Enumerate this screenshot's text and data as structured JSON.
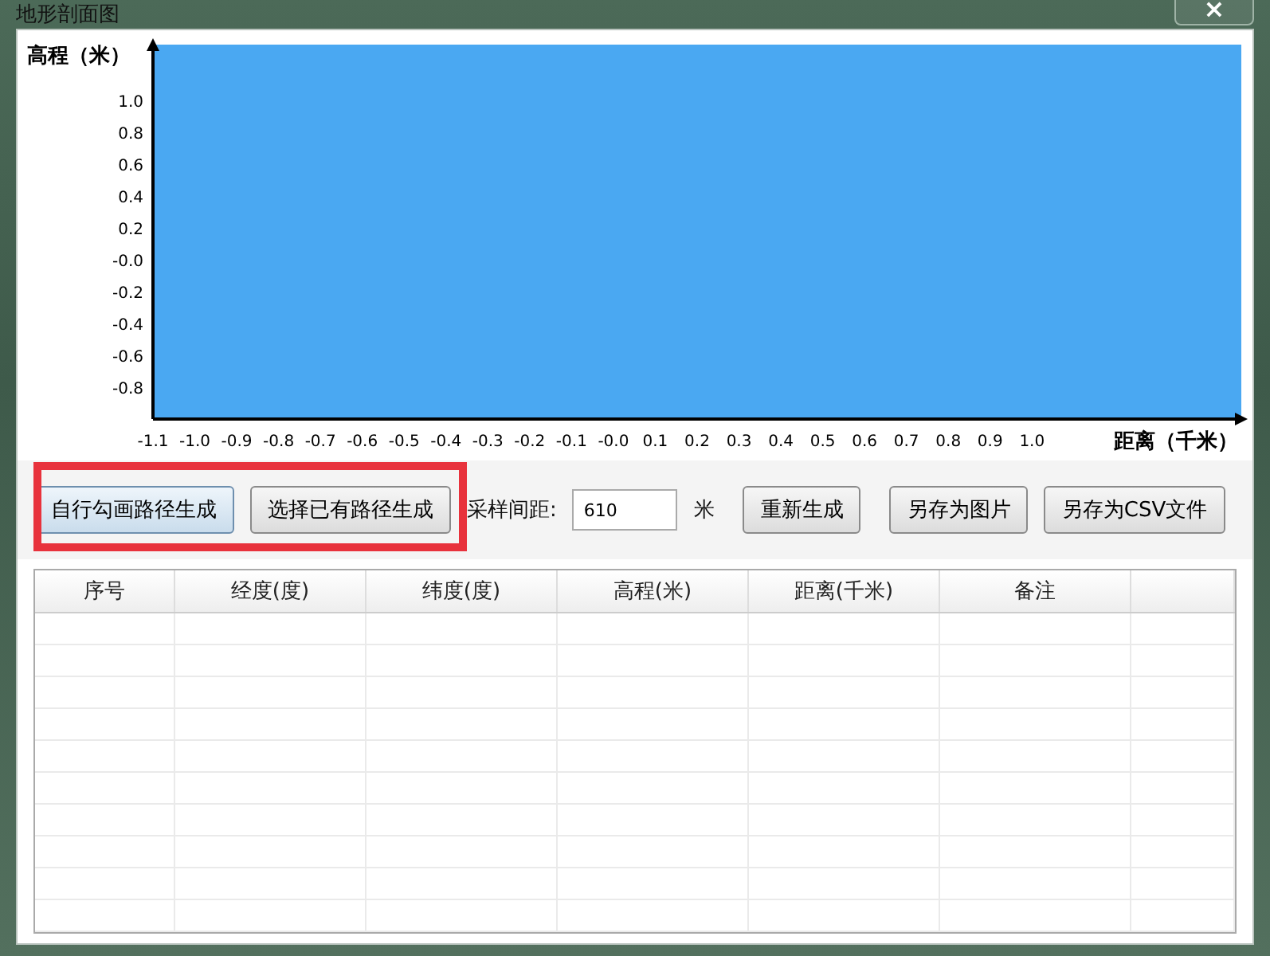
{
  "window": {
    "title": "地形剖面图",
    "close": "×"
  },
  "chart": {
    "chart_data": {
      "type": "area",
      "xlabel": "距离（千米）",
      "ylabel": "高程（米）",
      "xticks": [
        -1.1,
        {
          "value": -1,
          "label": "-1.0"
        },
        -0.9,
        -0.8,
        -0.7,
        -0.6,
        -0.5,
        -0.4,
        -0.3,
        -0.2,
        -0.1,
        {
          "value": 0,
          "label": "-0.0"
        },
        0.1,
        0.2,
        0.3,
        0.4,
        0.5,
        0.6,
        0.7,
        0.8,
        0.9,
        {
          "value": 1,
          "label": "1.0"
        }
      ],
      "yticks": [
        {
          "value": 1,
          "label": "1.0"
        },
        0.8,
        0.6,
        0.4,
        0.2,
        {
          "value": 0,
          "label": "-0.0"
        },
        -0.2,
        -0.4,
        -0.6,
        -0.8
      ],
      "xlim": [
        -1.1,
        1.5
      ],
      "ylim": [
        -1.0,
        1.35
      ]
    }
  },
  "controls": {
    "draw_path_button": "自行勾画路径生成",
    "pick_path_button": "选择已有路径生成",
    "interval_label": "采样间距:",
    "interval_value": "610",
    "interval_unit": "米",
    "regenerate_button": "重新生成",
    "save_image_button": "另存为图片",
    "save_csv_button": "另存为CSV文件"
  },
  "table": {
    "columns": [
      "序号",
      "经度(度)",
      "纬度(度)",
      "高程(米)",
      "距离(千米)",
      "备注",
      ""
    ]
  }
}
